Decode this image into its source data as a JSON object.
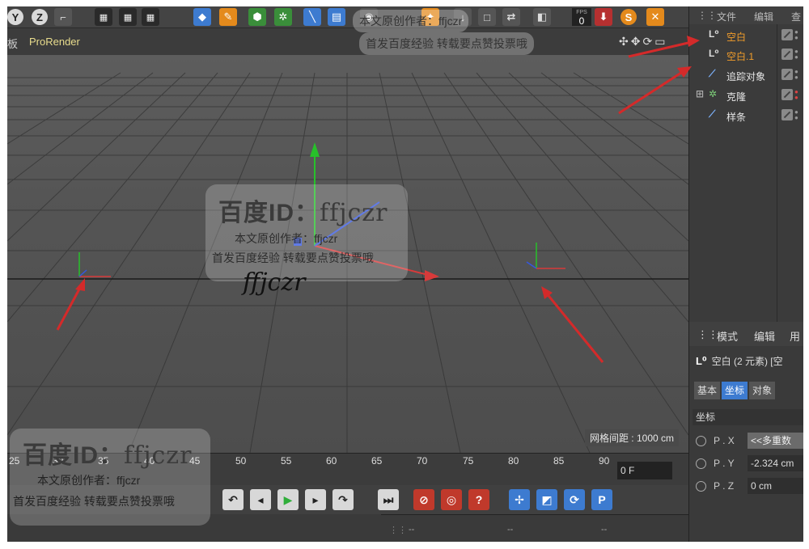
{
  "viewport_menu": {
    "partial": "板",
    "renderer": "ProRender"
  },
  "toolbar": {
    "counter_value": "0"
  },
  "object_manager": {
    "header": [
      "文件",
      "编辑",
      "查"
    ],
    "objects": [
      {
        "label": "空白",
        "icon": "null-icon",
        "selected": true
      },
      {
        "label": "空白.1",
        "icon": "null-icon",
        "selected": true
      },
      {
        "label": "追踪对象",
        "icon": "tracer-icon",
        "selected": false
      },
      {
        "label": "克隆",
        "icon": "cloner-icon",
        "selected": false
      },
      {
        "label": "样条",
        "icon": "spline-icon",
        "selected": false
      }
    ]
  },
  "attributes": {
    "header": [
      "模式",
      "编辑",
      "用"
    ],
    "title": "空白 (2 元素) [空",
    "tabs": [
      "基本",
      "坐标",
      "对象"
    ],
    "active_tab": "坐标",
    "section": "坐标",
    "params": [
      {
        "label": "P . X",
        "value": "<<多重数"
      },
      {
        "label": "P . Y",
        "value": "-2.324 cm"
      },
      {
        "label": "P . Z",
        "value": "0 cm"
      }
    ]
  },
  "viewport": {
    "grid_spacing": "网格间距 : 1000 cm"
  },
  "timeline": {
    "ticks": [
      "25",
      "30",
      "35",
      "40",
      "45",
      "50",
      "55",
      "60",
      "65",
      "70",
      "75",
      "80",
      "85",
      "90"
    ],
    "current_frame": "0 F"
  },
  "statusbar": {
    "items": [
      "--",
      "--",
      "--"
    ]
  },
  "watermarks": {
    "id_label": "百度ID：",
    "id_value": "ffjczr",
    "author": "本文原创作者：ffjczr",
    "author_top": "本文原创作者：ffjczr",
    "slogan": "首发百度经验  转载要点赞投票哦",
    "signature": "ffjczr"
  },
  "colors": {
    "accent": "#3d7bd0",
    "selected_text": "#f29d2a",
    "arrow": "#d42a2a"
  }
}
